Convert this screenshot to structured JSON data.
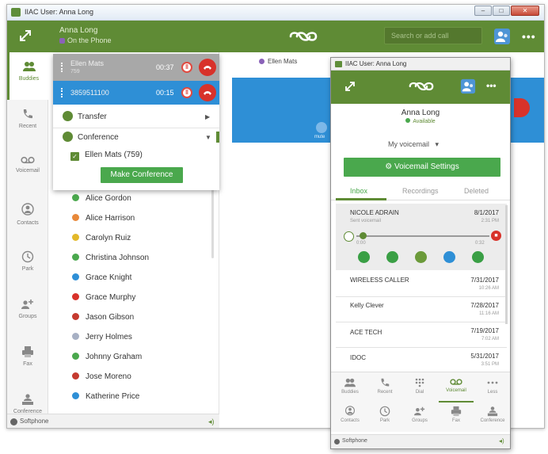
{
  "main_window": {
    "title": "IIAC User: Anna Long",
    "window_buttons": {
      "minimize": "–",
      "maximize": "□",
      "close": "✕"
    },
    "header": {
      "user_name": "Anna Long",
      "user_status": "On the Phone",
      "search_placeholder": "Search or add call",
      "more": "•••"
    },
    "sidebar": [
      {
        "label": "Buddies",
        "icon": "buddies-icon",
        "active": true
      },
      {
        "label": "Recent",
        "icon": "phone-icon",
        "active": false
      },
      {
        "label": "Voicemail",
        "icon": "voicemail-icon",
        "active": false
      },
      {
        "label": "Contacts",
        "icon": "contacts-icon",
        "active": false
      },
      {
        "label": "Park",
        "icon": "park-icon",
        "active": false
      },
      {
        "label": "Groups",
        "icon": "groups-icon",
        "active": false
      },
      {
        "label": "Fax",
        "icon": "fax-icon",
        "active": false
      },
      {
        "label": "Conference",
        "icon": "conference-icon",
        "active": false
      }
    ],
    "calls": [
      {
        "name": "Ellen Mats",
        "sub": "759",
        "time": "00:37",
        "state": "held"
      },
      {
        "name": "3859511100",
        "sub": "",
        "time": "00:15",
        "state": "active"
      }
    ],
    "call_menu": {
      "transfer": "Transfer",
      "conference": "Conference",
      "participant": "Ellen Mats (759)",
      "make_conference": "Make Conference"
    },
    "conversation_tab": "Ellen Mats",
    "mute_label": "mute",
    "contacts": [
      {
        "name": "Alice Gordon",
        "status": "available"
      },
      {
        "name": "Alice Harrison",
        "status": "away"
      },
      {
        "name": "Carolyn Ruiz",
        "status": "idle"
      },
      {
        "name": "Christina Johnson",
        "status": "available"
      },
      {
        "name": "Grace Knight",
        "status": "info"
      },
      {
        "name": "Grace Murphy",
        "status": "busy"
      },
      {
        "name": "Jason Gibson",
        "status": "dnd"
      },
      {
        "name": "Jerry Holmes",
        "status": "offline"
      },
      {
        "name": "Johnny Graham",
        "status": "available"
      },
      {
        "name": "Jose Moreno",
        "status": "dnd"
      },
      {
        "name": "Katherine Price",
        "status": "info"
      }
    ],
    "footer": {
      "label": "Softphone",
      "speaker": "◂)"
    }
  },
  "popup_window": {
    "title": "IIAC User: Anna Long",
    "user_name": "Anna Long",
    "user_status": "Available",
    "more": "•••",
    "mailbox_select": "My voicemail",
    "settings_button": "Voicemail Settings",
    "tabs": [
      "Inbox",
      "Recordings",
      "Deleted"
    ],
    "voicemails": [
      {
        "caller": "NICOLE ADRAIN",
        "sub": "Sent voicemail",
        "date": "8/1/2017",
        "time": "2:31 PM",
        "expanded": true
      },
      {
        "caller": "WIRELESS CALLER",
        "sub": "",
        "date": "7/31/2017",
        "time": "10:26 AM",
        "expanded": false
      },
      {
        "caller": "Kelly Clever",
        "sub": "",
        "date": "7/28/2017",
        "time": "11:16 AM",
        "expanded": false
      },
      {
        "caller": "ACE TECH",
        "sub": "",
        "date": "7/19/2017",
        "time": "7:02 AM",
        "expanded": false
      },
      {
        "caller": "IDOC",
        "sub": "",
        "date": "5/31/2017",
        "time": "3:51 PM",
        "expanded": false
      }
    ],
    "player": {
      "elapsed": "0:00",
      "total": "0:32",
      "progress_fraction": 0.04,
      "stop": "■"
    },
    "nav_row1": [
      {
        "label": "Buddies",
        "icon": "buddies-icon"
      },
      {
        "label": "Recent",
        "icon": "phone-icon"
      },
      {
        "label": "Dial",
        "icon": "dialpad-icon"
      },
      {
        "label": "Voicemail",
        "icon": "voicemail-icon",
        "active": true
      },
      {
        "label": "Less",
        "icon": "more-dots-icon"
      }
    ],
    "nav_row2": [
      {
        "label": "Contacts",
        "icon": "contacts-icon"
      },
      {
        "label": "Park",
        "icon": "park-icon"
      },
      {
        "label": "Groups",
        "icon": "groups-icon"
      },
      {
        "label": "Fax",
        "icon": "fax-icon"
      },
      {
        "label": "Conference",
        "icon": "conference-icon"
      }
    ],
    "footer": {
      "label": "Softphone",
      "speaker": "◂)"
    }
  },
  "colors": {
    "brand_green": "#5f8b35",
    "button_green": "#4aa84d",
    "active_call_blue": "#2e8fd6",
    "hangup_red": "#d8322a",
    "status_available": "#4aa84d",
    "status_away": "#e8893a",
    "status_idle": "#e3b829",
    "status_info": "#2e8fd6",
    "status_busy": "#d8322a",
    "status_dnd": "#c53a2f",
    "status_offline": "#a7b0c4"
  }
}
